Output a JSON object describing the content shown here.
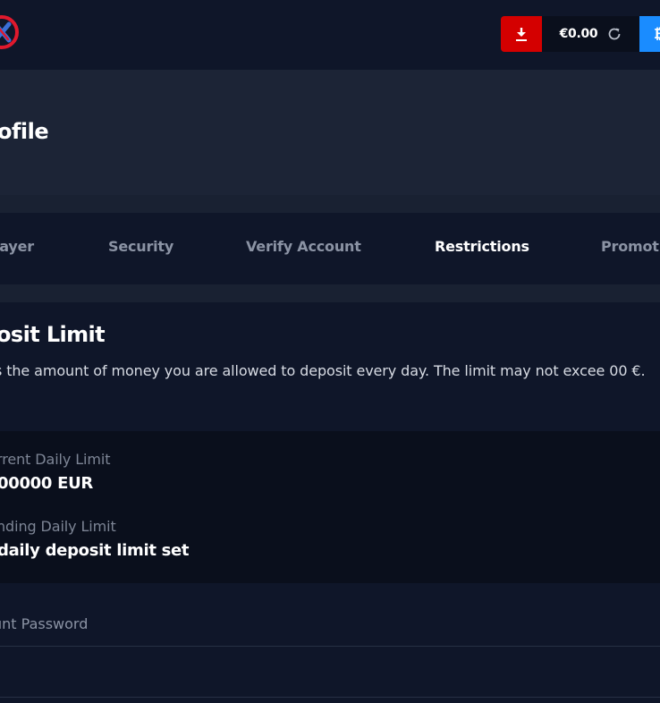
{
  "header": {
    "balance": "€0.00",
    "icons": {
      "logo": "logo-icon",
      "download": "download-icon",
      "refresh": "refresh-icon",
      "crypto": "bitcoin-icon"
    },
    "colors": {
      "download_bg": "#d40000",
      "crypto_bg": "#1a8cff",
      "balance_bg": "#0a0f1c"
    }
  },
  "profile": {
    "title": "ofile"
  },
  "tabs": [
    {
      "label": "layer",
      "active": false
    },
    {
      "label": "Security",
      "active": false
    },
    {
      "label": "Verify Account",
      "active": false
    },
    {
      "label": "Restrictions",
      "active": true
    },
    {
      "label": "Promot",
      "active": false
    }
  ],
  "deposit": {
    "title": "osit Limit",
    "description": "s the amount of money you are allowed to deposit every day. The limit may not excee 00 €."
  },
  "limits": {
    "current_label": "rrent Daily Limit",
    "current_value": "00000 EUR",
    "pending_label": "nding Daily Limit",
    "pending_value": "daily deposit limit set"
  },
  "password": {
    "label": "unt Password",
    "value": ""
  }
}
